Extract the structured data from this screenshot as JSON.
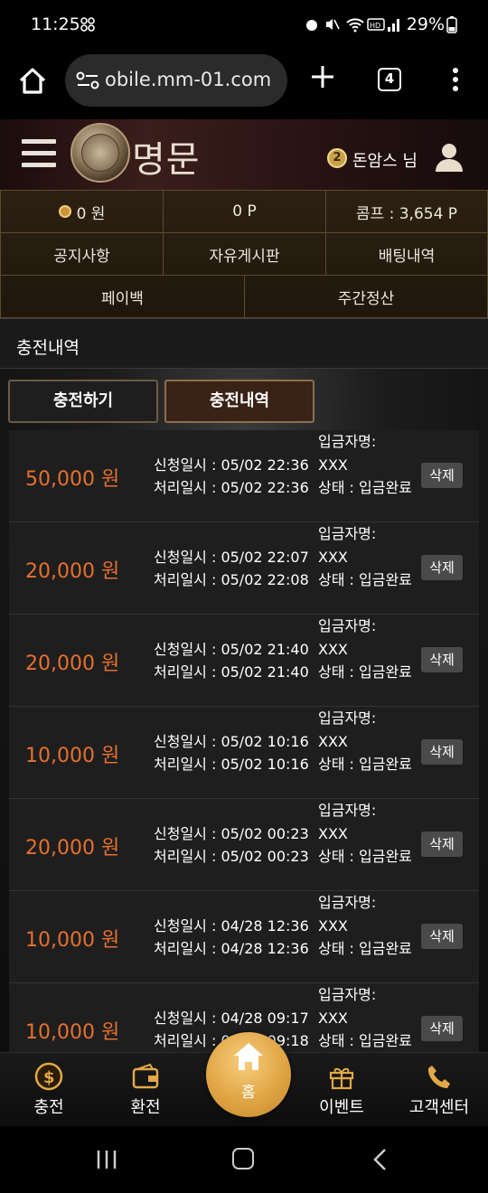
{
  "status": {
    "time": "11:25",
    "battery": "29%"
  },
  "browser": {
    "url": "obile.mm-01.com",
    "tab_count": "4"
  },
  "header": {
    "logo": "명문",
    "level": "2",
    "user": "돈암스 님"
  },
  "info": {
    "balance": "0 원",
    "points": "0 P",
    "comp": "콤프 : 3,654 P",
    "menu": [
      "공지사항",
      "자유게시판",
      "배팅내역",
      "페이백",
      "주간정산"
    ]
  },
  "section_title": "충전내역",
  "tabs": {
    "charge": "충전하기",
    "history": "충전내역"
  },
  "records": [
    {
      "amount": "50,000 원",
      "requested": "신청일시 : 05/02 22:36",
      "processed": "처리일시 : 05/02 22:36",
      "depositor_label": "입금자명:",
      "depositor": "XXX",
      "status": "상태 : 입금완료",
      "delete": "삭제"
    },
    {
      "amount": "20,000 원",
      "requested": "신청일시 : 05/02 22:07",
      "processed": "처리일시 : 05/02 22:08",
      "depositor_label": "입금자명:",
      "depositor": "XXX",
      "status": "상태 : 입금완료",
      "delete": "삭제"
    },
    {
      "amount": "20,000 원",
      "requested": "신청일시 : 05/02 21:40",
      "processed": "처리일시 : 05/02 21:40",
      "depositor_label": "입금자명:",
      "depositor": "XXX",
      "status": "상태 : 입금완료",
      "delete": "삭제"
    },
    {
      "amount": "10,000 원",
      "requested": "신청일시 : 05/02 10:16",
      "processed": "처리일시 : 05/02 10:16",
      "depositor_label": "입금자명:",
      "depositor": "XXX",
      "status": "상태 : 입금완료",
      "delete": "삭제"
    },
    {
      "amount": "20,000 원",
      "requested": "신청일시 : 05/02 00:23",
      "processed": "처리일시 : 05/02 00:23",
      "depositor_label": "입금자명:",
      "depositor": "XXX",
      "status": "상태 : 입금완료",
      "delete": "삭제"
    },
    {
      "amount": "10,000 원",
      "requested": "신청일시 : 04/28 12:36",
      "processed": "처리일시 : 04/28 12:36",
      "depositor_label": "입금자명:",
      "depositor": "XXX",
      "status": "상태 : 입금완료",
      "delete": "삭제"
    },
    {
      "amount": "10,000 원",
      "requested": "신청일시 : 04/28 09:17",
      "processed": "처리일시 : 04/28 09:18",
      "depositor_label": "입금자명:",
      "depositor": "XXX",
      "status": "상태 : 입금완료",
      "delete": "삭제"
    }
  ],
  "bottom_nav": {
    "charge": "충전",
    "exchange": "환전",
    "home": "홈",
    "event": "이벤트",
    "support": "고객센터"
  },
  "colors": {
    "accent": "#e6702f",
    "gold": "#e2a848"
  }
}
